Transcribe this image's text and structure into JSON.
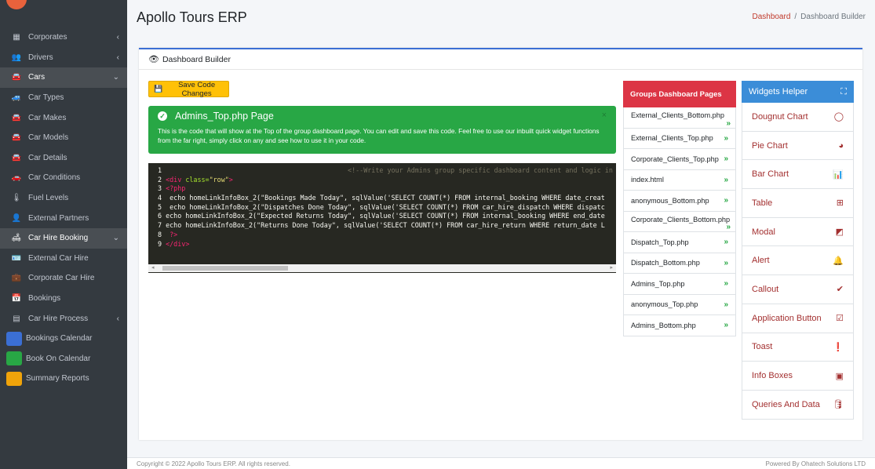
{
  "app": {
    "title": "Apollo Tours ERP"
  },
  "breadcrumb": {
    "home": "Dashboard",
    "separator": "/",
    "current": "Dashboard Builder"
  },
  "sidebar": {
    "items": [
      {
        "label": "Corporates",
        "icon": "building-icon",
        "glyph": "▦",
        "chevron": "‹"
      },
      {
        "label": "Drivers",
        "icon": "users-icon",
        "glyph": "👥",
        "chevron": "‹"
      },
      {
        "label": "Cars",
        "icon": "car-icon",
        "glyph": "🚘",
        "chevron": "⌄"
      },
      {
        "label": "Car Types",
        "icon": "car-side-icon",
        "glyph": "🚙",
        "chevron": ""
      },
      {
        "label": "Car Makes",
        "icon": "car-icon",
        "glyph": "🚘",
        "chevron": ""
      },
      {
        "label": "Car Models",
        "icon": "car-icon",
        "glyph": "🚘",
        "chevron": ""
      },
      {
        "label": "Car Details",
        "icon": "car-icon",
        "glyph": "🚘",
        "chevron": ""
      },
      {
        "label": "Car Conditions",
        "icon": "car-crash-icon",
        "glyph": "🚗",
        "chevron": ""
      },
      {
        "label": "Fuel Levels",
        "icon": "thermometer-icon",
        "glyph": "🌡",
        "chevron": ""
      },
      {
        "label": "External Partners",
        "icon": "partners-icon",
        "glyph": "👤",
        "chevron": ""
      },
      {
        "label": "Car Hire Booking",
        "icon": "couch-icon",
        "glyph": "🛋",
        "chevron": "⌄"
      },
      {
        "label": "External Car Hire",
        "icon": "id-card-icon",
        "glyph": "🪪",
        "chevron": ""
      },
      {
        "label": "Corporate Car Hire",
        "icon": "briefcase-icon",
        "glyph": "💼",
        "chevron": ""
      },
      {
        "label": "Bookings",
        "icon": "calendar-check-icon",
        "glyph": "📅",
        "chevron": ""
      },
      {
        "label": "Car Hire Process",
        "icon": "list-icon",
        "glyph": "▤",
        "chevron": "‹"
      },
      {
        "label": "Bookings Calendar",
        "icon": "calendar-icon",
        "glyph": "",
        "chevron": ""
      },
      {
        "label": "Book On Calendar",
        "icon": "book-calendar-icon",
        "glyph": "",
        "chevron": ""
      },
      {
        "label": "Summary Reports",
        "icon": "reports-icon",
        "glyph": "",
        "chevron": ""
      }
    ]
  },
  "card": {
    "header": "Dashboard Builder",
    "save_label": "Save Code Changes"
  },
  "alert": {
    "title": "Admins_Top.php Page",
    "body": "This is the code that will show at the Top of the group dashboard page. You can edit and save this code. Feel free to use our inbuilt quick widget functions from the far right, simply click on any and see how to use it in your code.",
    "close": "×"
  },
  "code": {
    "lines": [
      {
        "n": "1",
        "text": "                                              <!--Write your Admins group specific dashboard content and logic in her"
      },
      {
        "n": "2",
        "text": "<div class=\"row\">"
      },
      {
        "n": "3",
        "text": "<?php"
      },
      {
        "n": "4",
        "text": " echo homeLinkInfoBox_2(\"Bookings Made Today\", sqlValue('SELECT COUNT(*) FROM internal_booking WHERE date_creat"
      },
      {
        "n": "5",
        "text": " echo homeLinkInfoBox_2(\"Dispatches Done Today\", sqlValue('SELECT COUNT(*) FROM car_hire_dispatch WHERE dispatc"
      },
      {
        "n": "6",
        "text": "echo homeLinkInfoBox_2(\"Expected Returns Today\", sqlValue('SELECT COUNT(*) FROM internal_booking WHERE end_date"
      },
      {
        "n": "7",
        "text": "echo homeLinkInfoBox_2(\"Returns Done Today\", sqlValue('SELECT COUNT(*) FROM car_hire_return WHERE return_date L"
      },
      {
        "n": "8",
        "text": " ?>"
      },
      {
        "n": "9",
        "text": "</div>"
      }
    ]
  },
  "groups": {
    "title": "Groups Dashboard Pages",
    "items": [
      {
        "label": "External_Clients_Bottom.php",
        "wrap": true
      },
      {
        "label": "External_Clients_Top.php",
        "wrap": false
      },
      {
        "label": "Corporate_Clients_Top.php",
        "wrap": false
      },
      {
        "label": "index.html",
        "wrap": false
      },
      {
        "label": "anonymous_Bottom.php",
        "wrap": false
      },
      {
        "label": "Corporate_Clients_Bottom.php",
        "wrap": true
      },
      {
        "label": "Dispatch_Top.php",
        "wrap": false
      },
      {
        "label": "Dispatch_Bottom.php",
        "wrap": false
      },
      {
        "label": "Admins_Top.php",
        "wrap": false
      },
      {
        "label": "anonymous_Top.php",
        "wrap": false
      },
      {
        "label": "Admins_Bottom.php",
        "wrap": false
      }
    ],
    "arrow": "»"
  },
  "widgets": {
    "title": "Widgets Helper",
    "items": [
      {
        "label": "Dougnut Chart",
        "icon": "donut-icon",
        "glyph": "◯"
      },
      {
        "label": "Pie Chart",
        "icon": "pie-chart-icon",
        "glyph": "◕"
      },
      {
        "label": "Bar Chart",
        "icon": "bar-chart-icon",
        "glyph": "📊"
      },
      {
        "label": "Table",
        "icon": "table-icon",
        "glyph": "⊞"
      },
      {
        "label": "Modal",
        "icon": "modal-icon",
        "glyph": "◩"
      },
      {
        "label": "Alert",
        "icon": "bell-icon",
        "glyph": "🔔"
      },
      {
        "label": "Callout",
        "icon": "check-double-icon",
        "glyph": "✔"
      },
      {
        "label": "Application Button",
        "icon": "checkbox-icon",
        "glyph": "☑"
      },
      {
        "label": "Toast",
        "icon": "exclamation-icon",
        "glyph": "❗"
      },
      {
        "label": "Info Boxes",
        "icon": "id-box-icon",
        "glyph": "▣"
      },
      {
        "label": "Queries And Data",
        "icon": "database-icon",
        "glyph": "🛢"
      }
    ]
  },
  "footer": {
    "left": "Copyright © 2022 Apollo Tours ERP. All rights reserved.",
    "right": "Powered By Ohatech Solutions LTD"
  },
  "colors": {
    "accent": "#3b6fd4",
    "danger": "#dc3545",
    "success": "#28a745",
    "warning": "#ffc107",
    "info": "#3b8dd8",
    "sidebar": "#343a40"
  }
}
